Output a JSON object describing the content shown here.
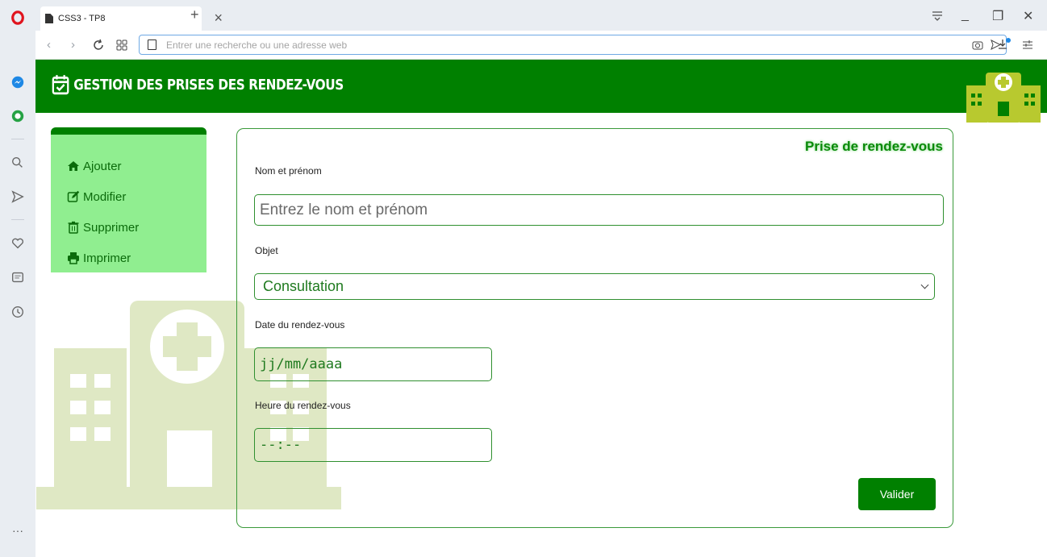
{
  "browser": {
    "tab_title": "CSS3 - TP8",
    "tab_close": "×",
    "new_tab": "+",
    "url_placeholder": "Entrer une recherche ou une adresse web",
    "minimize": "_",
    "restore": "❐",
    "close": "✕",
    "more": "···"
  },
  "header": {
    "title": "GESTION DES PRISES DES RENDEZ-VOUS"
  },
  "menu": {
    "items": [
      {
        "label": "Ajouter",
        "icon": "home-icon"
      },
      {
        "label": "Modifier",
        "icon": "edit-icon"
      },
      {
        "label": "Supprimer",
        "icon": "trash-icon"
      },
      {
        "label": "Imprimer",
        "icon": "print-icon"
      }
    ]
  },
  "form": {
    "title": "Prise de rendez-vous",
    "name_label": "Nom et prénom",
    "name_placeholder": "Entrez le nom et prénom",
    "objet_label": "Objet",
    "objet_value": "Consultation",
    "date_label": "Date du rendez-vous",
    "date_placeholder": "jj/mm/aaaa",
    "time_label": "Heure du rendez-vous",
    "time_placeholder": "--:--",
    "submit_label": "Valider"
  },
  "colors": {
    "primary": "#008000",
    "menu_bg": "#90ee90",
    "illustration": "#dfe8c4"
  }
}
